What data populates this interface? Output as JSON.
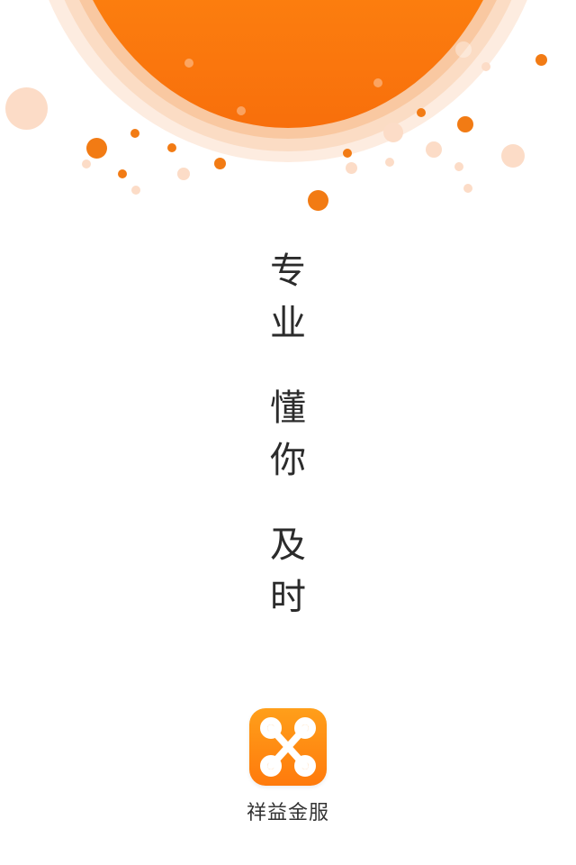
{
  "splash": {
    "slogan": [
      [
        "专",
        "业"
      ],
      [
        "懂",
        "你"
      ],
      [
        "及",
        "时"
      ]
    ],
    "brand_name": "祥益金服",
    "logo_icon": "interlocking-x-logo-icon",
    "colors": {
      "accent": "#f27b14",
      "sun": "#ff8a10",
      "text": "#2b2b2b"
    }
  }
}
